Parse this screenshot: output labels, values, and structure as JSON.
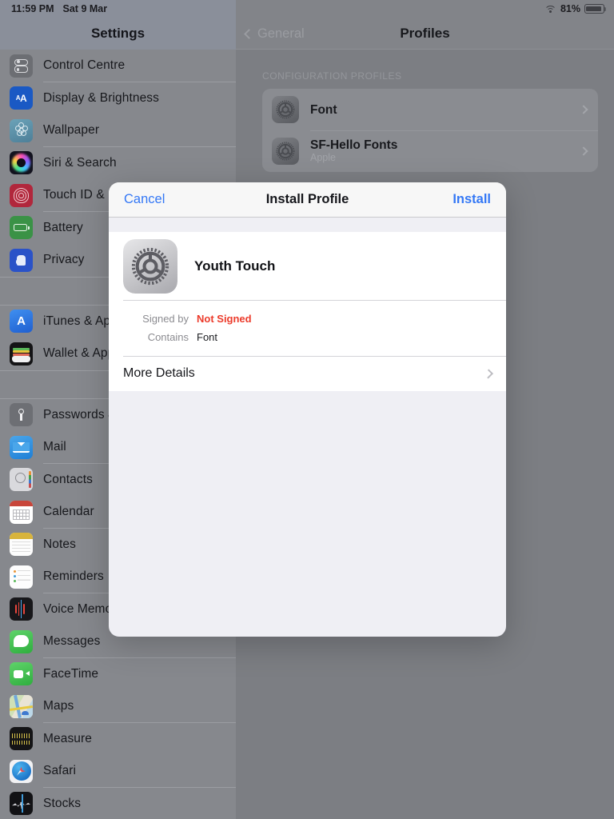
{
  "status_bar": {
    "time": "11:59 PM",
    "date": "Sat 9 Mar",
    "wifi_icon": "wifi-icon",
    "battery_percent": "81%",
    "battery_icon": "battery-icon"
  },
  "sidebar": {
    "title": "Settings",
    "groups": [
      {
        "items": [
          {
            "label": "Control Centre",
            "icon": "control-centre-icon",
            "icon_class": "ic-ctrl",
            "parts": 2
          },
          {
            "label": "Display & Brightness",
            "icon": "display-brightness-icon",
            "icon_class": "ic-display",
            "parts": 0
          },
          {
            "label": "Wallpaper",
            "icon": "wallpaper-icon",
            "icon_class": "ic-wall",
            "parts": 6
          },
          {
            "label": "Siri & Search",
            "icon": "siri-search-icon",
            "icon_class": "ic-siri",
            "parts": 1
          },
          {
            "label": "Touch ID & Passcode",
            "icon": "touch-id-icon",
            "icon_class": "ic-touch",
            "parts": 3
          },
          {
            "label": "Battery",
            "icon": "battery-settings-icon",
            "icon_class": "ic-batt",
            "parts": 1
          },
          {
            "label": "Privacy",
            "icon": "privacy-icon",
            "icon_class": "ic-priv",
            "parts": 1
          }
        ]
      },
      {
        "items": [
          {
            "label": "iTunes & App Store",
            "icon": "itunes-app-store-icon",
            "icon_class": "ic-itunes",
            "parts": 0
          },
          {
            "label": "Wallet & Apple Pay",
            "icon": "wallet-apple-pay-icon",
            "icon_class": "ic-wallet",
            "parts": 3
          }
        ]
      },
      {
        "items": [
          {
            "label": "Passwords & Accounts",
            "icon": "passwords-accounts-icon",
            "icon_class": "ic-pass",
            "parts": 1
          },
          {
            "label": "Mail",
            "icon": "mail-icon",
            "icon_class": "ic-mail",
            "parts": 1
          },
          {
            "label": "Contacts",
            "icon": "contacts-icon",
            "icon_class": "ic-contacts",
            "parts": 1
          },
          {
            "label": "Calendar",
            "icon": "calendar-icon",
            "icon_class": "ic-cal",
            "parts": 1
          },
          {
            "label": "Notes",
            "icon": "notes-icon",
            "icon_class": "ic-notes",
            "parts": 1
          },
          {
            "label": "Reminders",
            "icon": "reminders-icon",
            "icon_class": "ic-rem",
            "parts": 3
          },
          {
            "label": "Voice Memos",
            "icon": "voice-memos-icon",
            "icon_class": "ic-voice",
            "parts": 3
          },
          {
            "label": "Messages",
            "icon": "messages-icon",
            "icon_class": "ic-msg",
            "parts": 1
          },
          {
            "label": "FaceTime",
            "icon": "facetime-icon",
            "icon_class": "ic-face",
            "parts": 1
          },
          {
            "label": "Maps",
            "icon": "maps-icon",
            "icon_class": "ic-maps",
            "parts": 3
          },
          {
            "label": "Measure",
            "icon": "measure-icon",
            "icon_class": "ic-meas",
            "parts": 1
          },
          {
            "label": "Safari",
            "icon": "safari-icon",
            "icon_class": "ic-safari",
            "parts": 1
          },
          {
            "label": "Stocks",
            "icon": "stocks-icon",
            "icon_class": "ic-stocks",
            "parts": 2
          }
        ]
      }
    ]
  },
  "detail": {
    "back_label": "General",
    "back_icon": "chevron-left-icon",
    "title": "Profiles",
    "section_header": "CONFIGURATION PROFILES",
    "profiles": [
      {
        "name": "Font",
        "subtitle": "",
        "icon": "settings-gear-icon",
        "chevron": "chevron-right-icon"
      },
      {
        "name": "SF-Hello Fonts",
        "subtitle": "Apple",
        "icon": "settings-gear-icon",
        "chevron": "chevron-right-icon"
      }
    ]
  },
  "modal": {
    "cancel_label": "Cancel",
    "title": "Install Profile",
    "install_label": "Install",
    "profile": {
      "name": "Youth Touch",
      "icon": "settings-gear-icon"
    },
    "fields": [
      {
        "key": "Signed by",
        "value": "Not Signed",
        "danger": true
      },
      {
        "key": "Contains",
        "value": "Font",
        "danger": false
      }
    ],
    "more_details_label": "More Details",
    "more_details_chevron": "chevron-right-icon"
  },
  "colors": {
    "accent_blue": "#3478f6",
    "danger_red": "#ec3b2b",
    "dim_overlay": "#7c7e83",
    "grouped_bg": "#efeff4"
  }
}
